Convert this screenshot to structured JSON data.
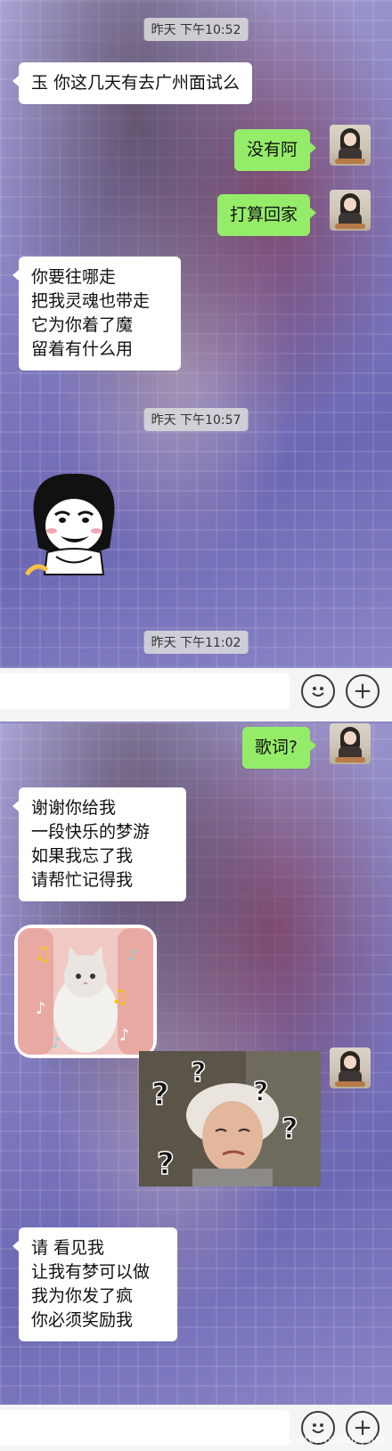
{
  "panel1": {
    "timestamps": [
      "昨天 下午10:52",
      "昨天 下午10:57",
      "昨天 下午11:02"
    ],
    "messages": [
      {
        "side": "in",
        "text": "玉 你这几天有去广州面试么"
      },
      {
        "side": "out",
        "text": "没有阿"
      },
      {
        "side": "out",
        "text": "打算回家"
      },
      {
        "side": "in",
        "text": "你要往哪走\n把我灵魂也带走\n它为你着了魔\n留着有什么用"
      }
    ],
    "sticker": "meme-face-sticker"
  },
  "panel2": {
    "messages": [
      {
        "side": "out",
        "text": "歌词?"
      },
      {
        "side": "in",
        "text": "谢谢你给我\n一段快乐的梦游\n如果我忘了我\n请帮忙记得我"
      },
      {
        "side": "in",
        "text": "请 看见我\n让我有梦可以做\n我为你发了疯\n你必须奖励我"
      }
    ],
    "cat_sticker": "singing-cat-sticker",
    "confused_sticker": "confused-woman-sticker"
  },
  "input_bar": {
    "emoji_icon": "emoji-icon",
    "plus_icon": "plus-icon",
    "plus_glyph": "+"
  },
  "watermark": "@Shutterbugbugbug",
  "colors": {
    "outgoing_bubble": "#95ec69",
    "incoming_bubble": "#ffffff"
  }
}
